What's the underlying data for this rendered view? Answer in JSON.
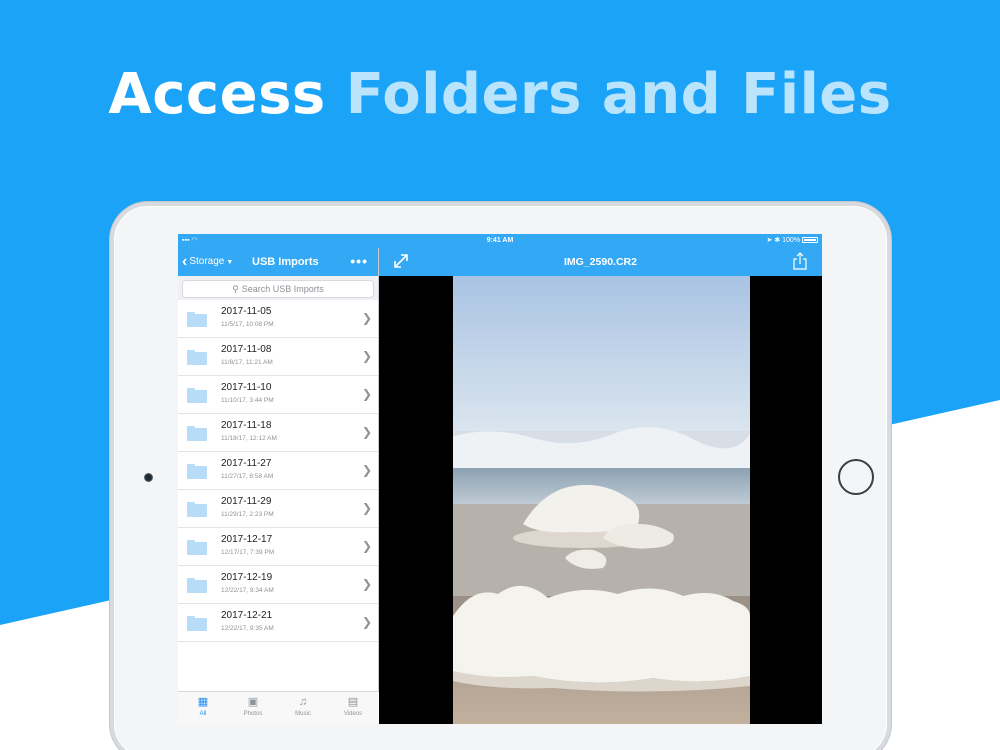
{
  "headline": {
    "word1": "Access",
    "rest": "Folders and Files"
  },
  "colors": {
    "background": "#1aa3f7",
    "nav": "#33a8f4",
    "accent_text": "#b9e4fc",
    "tab_active": "#1f8ef0"
  },
  "status_bar": {
    "time": "9:41 AM",
    "battery": "100%"
  },
  "left_nav": {
    "back_label": "Storage",
    "title": "USB Imports",
    "more": "•••"
  },
  "search": {
    "placeholder": "Search USB Imports"
  },
  "folders": [
    {
      "name": "2017-11-05",
      "date": "11/5/17, 10:08 PM"
    },
    {
      "name": "2017-11-08",
      "date": "11/8/17, 11:21 AM"
    },
    {
      "name": "2017-11-10",
      "date": "11/10/17, 3:44 PM"
    },
    {
      "name": "2017-11-18",
      "date": "11/18/17, 12:12 AM"
    },
    {
      "name": "2017-11-27",
      "date": "11/27/17, 8:58 AM"
    },
    {
      "name": "2017-11-29",
      "date": "11/29/17, 2:23 PM"
    },
    {
      "name": "2017-12-17",
      "date": "12/17/17, 7:39 PM"
    },
    {
      "name": "2017-12-19",
      "date": "12/22/17, 9:34 AM"
    },
    {
      "name": "2017-12-21",
      "date": "12/22/17, 9:35 AM"
    }
  ],
  "tabs": [
    {
      "label": "All",
      "icon": "all-icon",
      "active": true
    },
    {
      "label": "Photos",
      "icon": "photos-icon",
      "active": false
    },
    {
      "label": "Music",
      "icon": "music-icon",
      "active": false
    },
    {
      "label": "Videos",
      "icon": "videos-icon",
      "active": false
    }
  ],
  "viewer": {
    "title": "IMG_2590.CR2"
  }
}
